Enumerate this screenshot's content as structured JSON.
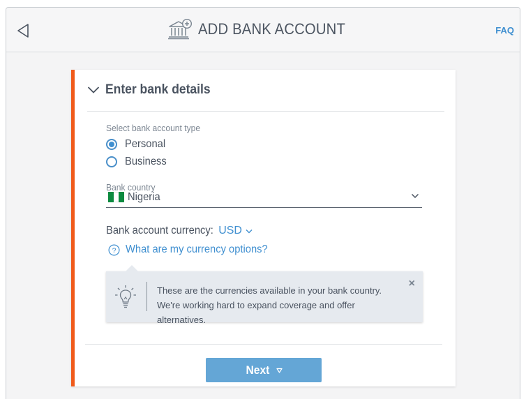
{
  "header": {
    "title": "ADD BANK ACCOUNT",
    "faq_label": "FAQ",
    "back_icon": "back-triangle-icon",
    "title_icon": "bank-add-icon"
  },
  "form": {
    "section_title": "Enter bank details",
    "account_type": {
      "label": "Select bank account type",
      "options": [
        {
          "label": "Personal",
          "selected": true
        },
        {
          "label": "Business",
          "selected": false
        }
      ]
    },
    "country": {
      "label": "Bank country",
      "value": "Nigeria",
      "flag_colors": [
        "#0c8a3f",
        "#ffffff",
        "#0c8a3f"
      ]
    },
    "currency": {
      "label": "Bank account currency:",
      "value": "USD"
    },
    "help_link": "What are my currency options?",
    "tooltip": {
      "text": "These are the currencies available in your bank country. We're working hard to expand coverage and offer alternatives.",
      "close_label": "×",
      "icon": "lightbulb-icon"
    },
    "next_label": "Next"
  },
  "colors": {
    "accent": "#f05a1a",
    "link": "#3f8fd0",
    "button": "#64a6d6"
  }
}
